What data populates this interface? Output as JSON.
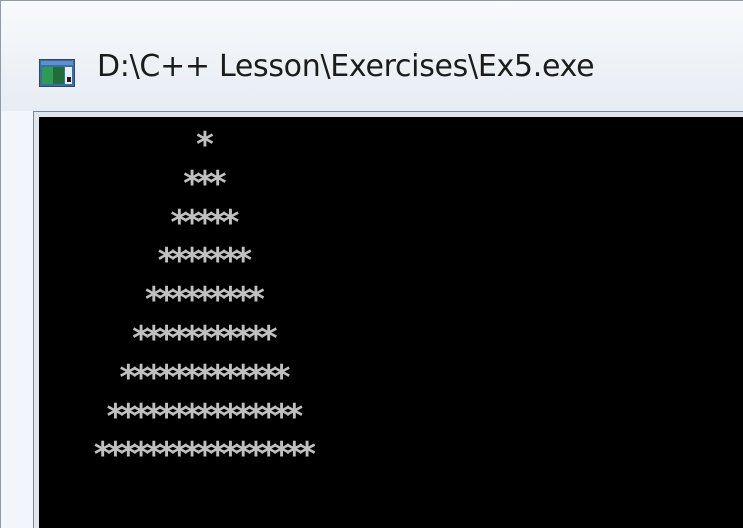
{
  "window": {
    "title": "D:\\C++ Lesson\\Exercises\\Ex5.exe",
    "icon": "console-window-icon"
  },
  "console": {
    "background": "#000000",
    "text_color": "#c0c0c0",
    "output": "          *\n         ***\n        *****\n       *******\n      *********\n     ***********\n    *************\n   ***************\n  *****************"
  }
}
